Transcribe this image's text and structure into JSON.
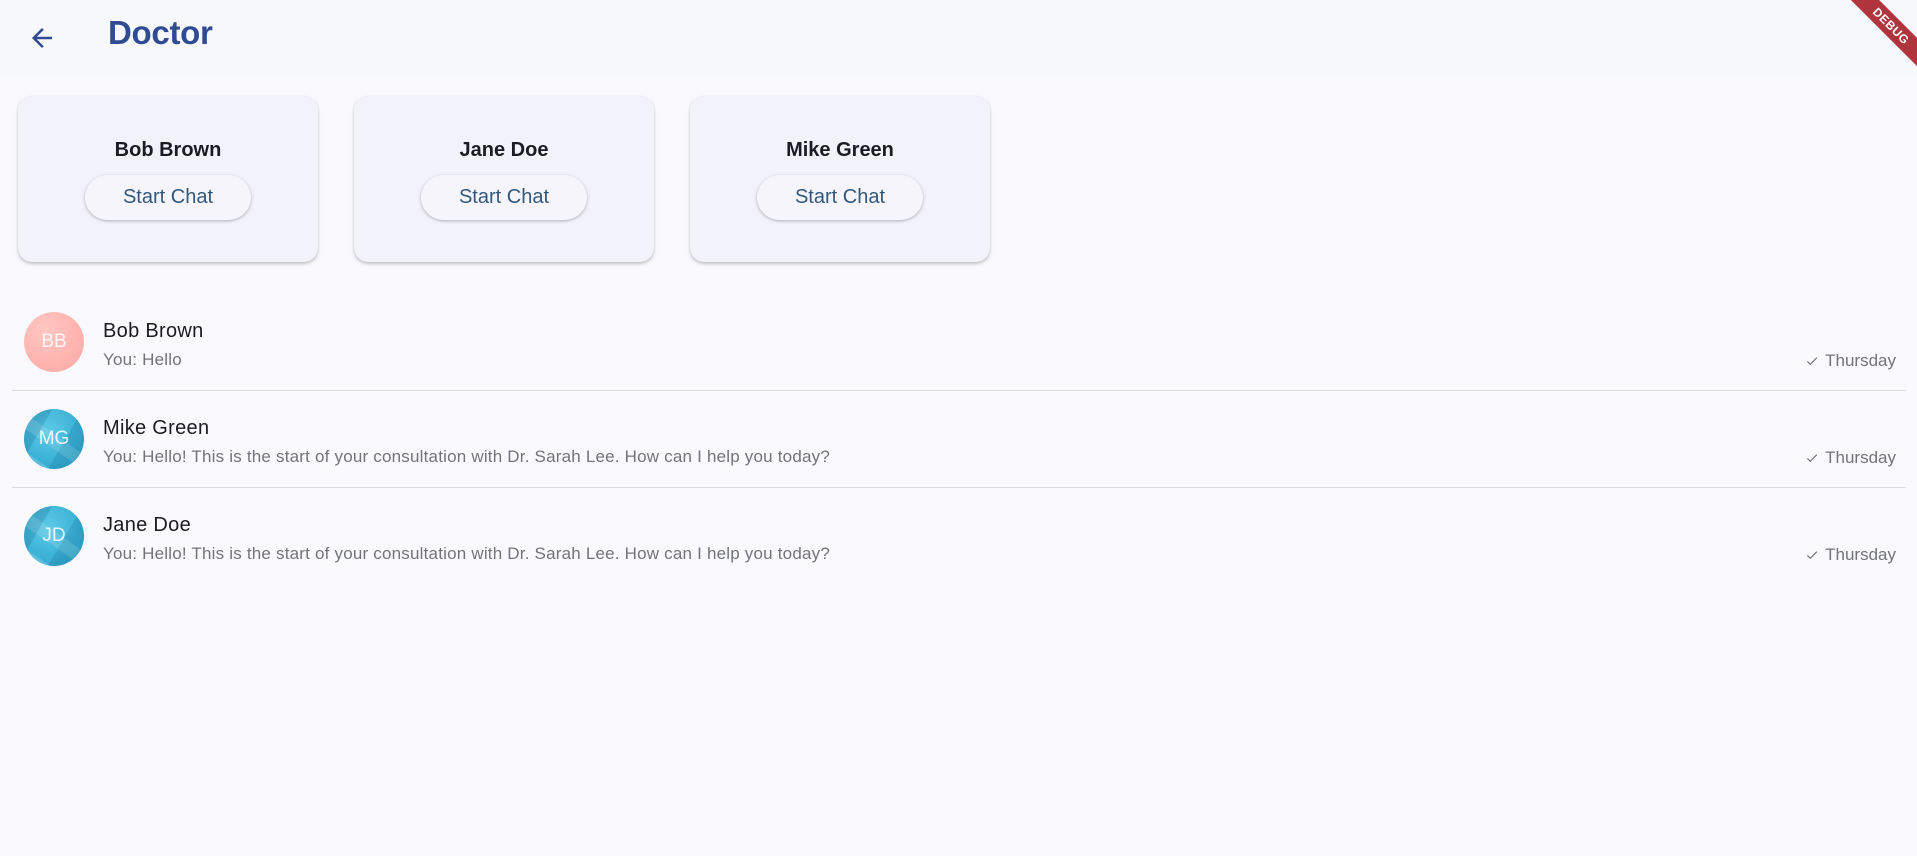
{
  "colors": {
    "accent": "#2f4c93",
    "debug_banner": "#b0343d",
    "avatar_pink": "#ffb5b0",
    "avatar_blue": "#3cb3d6"
  },
  "header": {
    "back_icon": "arrow-left-icon",
    "title": "Doctor"
  },
  "debug_banner": "DEBUG",
  "doctor_cards": [
    {
      "name": "Bob Brown",
      "button_label": "Start Chat"
    },
    {
      "name": "Jane Doe",
      "button_label": "Start Chat"
    },
    {
      "name": "Mike Green",
      "button_label": "Start Chat"
    }
  ],
  "chats": [
    {
      "initials": "BB",
      "avatar_style": "pink",
      "name": "Bob Brown",
      "preview": "You: Hello",
      "status_icon": "check-icon",
      "time": "Thursday"
    },
    {
      "initials": "MG",
      "avatar_style": "blue",
      "name": "Mike Green",
      "preview": "You: Hello! This is the start of your consultation with Dr. Sarah Lee. How can I help you today?",
      "status_icon": "check-icon",
      "time": "Thursday"
    },
    {
      "initials": "JD",
      "avatar_style": "blue",
      "name": "Jane Doe",
      "preview": "You: Hello! This is the start of your consultation with Dr. Sarah Lee. How can I help you today?",
      "status_icon": "check-icon",
      "time": "Thursday"
    }
  ]
}
